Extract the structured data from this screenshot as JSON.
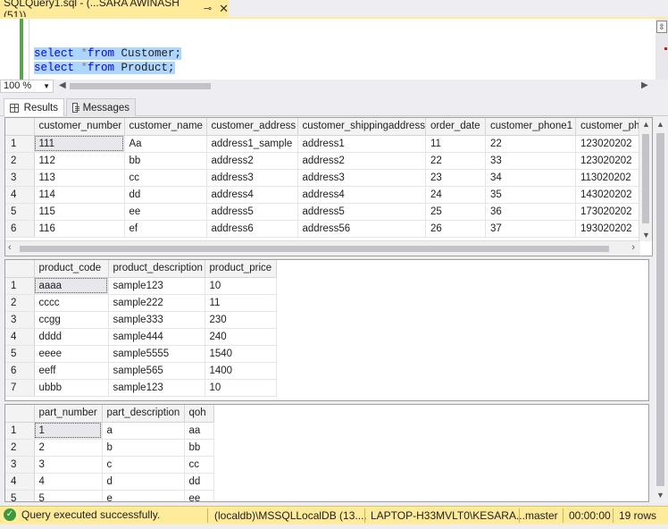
{
  "tab": {
    "title": "SQLQuery1.sql - (...SARA AWINASH (51))",
    "pin": "⊸",
    "close": "✕"
  },
  "editor": {
    "lines": [
      {
        "kw1": "select",
        "op": " *",
        "kw2": "from",
        "rest": " Customer;"
      },
      {
        "kw1": "select",
        "op": " *",
        "kw2": "from",
        "rest": " Product;"
      }
    ]
  },
  "zoom": {
    "value": "100 %"
  },
  "result_tabs": {
    "results": "Results",
    "messages": "Messages"
  },
  "grid1": {
    "columns": [
      "customer_number",
      "customer_name",
      "customer_address",
      "customer_shippingaddress",
      "order_date",
      "customer_phone1",
      "customer_pho"
    ],
    "rows": [
      [
        "1",
        "111",
        "Aa",
        "address1_sample",
        "address1",
        "11",
        "22",
        "123020202"
      ],
      [
        "2",
        "112",
        "bb",
        "address2",
        "address2",
        "22",
        "33",
        "123020202"
      ],
      [
        "3",
        "113",
        "cc",
        "address3",
        "address3",
        "23",
        "34",
        "113020202"
      ],
      [
        "4",
        "114",
        "dd",
        "address4",
        "address4",
        "24",
        "35",
        "143020202"
      ],
      [
        "5",
        "115",
        "ee",
        "address5",
        "address5",
        "25",
        "36",
        "173020202"
      ],
      [
        "6",
        "116",
        "ef",
        "address6",
        "address56",
        "26",
        "37",
        "193020202"
      ]
    ]
  },
  "grid2": {
    "columns": [
      "product_code",
      "product_description",
      "product_price"
    ],
    "rows": [
      [
        "1",
        "aaaa",
        "sample123",
        "10"
      ],
      [
        "2",
        "cccc",
        "sample222",
        "11"
      ],
      [
        "3",
        "ccgg",
        "sample333",
        "230"
      ],
      [
        "4",
        "dddd",
        "sample444",
        "240"
      ],
      [
        "5",
        "eeee",
        "sample5555",
        "1540"
      ],
      [
        "6",
        "eeff",
        "sample565",
        "1400"
      ],
      [
        "7",
        "ubbb",
        "sample123",
        "10"
      ]
    ]
  },
  "grid3": {
    "columns": [
      "part_number",
      "part_description",
      "qoh"
    ],
    "rows": [
      [
        "1",
        "1",
        "a",
        "aa"
      ],
      [
        "2",
        "2",
        "b",
        "bb"
      ],
      [
        "3",
        "3",
        "c",
        "cc"
      ],
      [
        "4",
        "4",
        "d",
        "dd"
      ],
      [
        "5",
        "5",
        "e",
        "ee"
      ]
    ]
  },
  "status": {
    "message": "Query executed successfully.",
    "server": "(localdb)\\MSSQLLocalDB (13....",
    "user": "LAPTOP-H33MVLT0\\KESARA...",
    "database": "master",
    "elapsed": "00:00:00",
    "rows": "19 rows"
  },
  "colors": {
    "status_bar": "#ffeb99",
    "selection": "#add6ff",
    "keyword": "#0000ff"
  }
}
